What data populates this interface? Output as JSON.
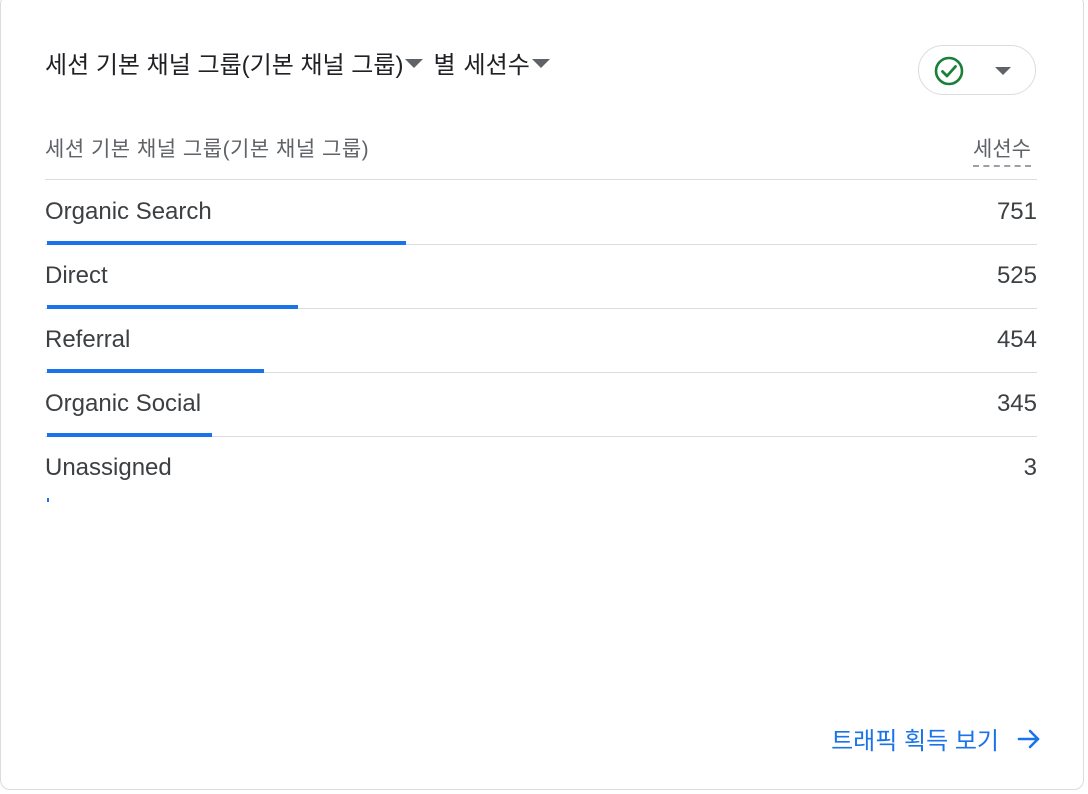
{
  "card": {
    "title": {
      "dimension": "세션 기본 채널 그룹(기본 채널 그룹)",
      "connector": "별",
      "metric": "세션수"
    },
    "status_icon": "check-circle-icon",
    "table": {
      "dimension_header": "세션 기본 채널 그룹(기본 채널 그룹)",
      "metric_header": "세션수",
      "rows": [
        {
          "label": "Organic Search",
          "value": "751",
          "share": 0.362
        },
        {
          "label": "Direct",
          "value": "525",
          "share": 0.253
        },
        {
          "label": "Referral",
          "value": "454",
          "share": 0.219
        },
        {
          "label": "Organic Social",
          "value": "345",
          "share": 0.166
        },
        {
          "label": "Unassigned",
          "value": "3",
          "share": 0.0014
        }
      ]
    },
    "footer": {
      "link_label": "트래픽 획득 보기",
      "link_icon": "arrow-right-icon"
    }
  },
  "colors": {
    "accent": "#1a73e8",
    "success": "#188038",
    "divider": "#dadce0"
  }
}
